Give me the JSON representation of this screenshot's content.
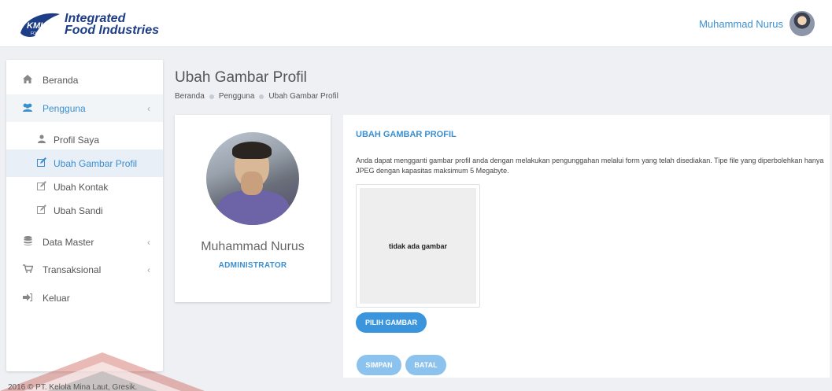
{
  "brand": {
    "line1": "Integrated",
    "line2": "Food Industries",
    "mark_text": "KML",
    "mark_sub": "FOOD"
  },
  "user": {
    "name": "Muhammad Nurus"
  },
  "sidebar": {
    "items": [
      {
        "label": "Beranda",
        "icon": "home-icon"
      },
      {
        "label": "Pengguna",
        "icon": "users-icon",
        "chevron": "‹"
      },
      {
        "label": "Profil Saya",
        "icon": "user-icon"
      },
      {
        "label": "Ubah Gambar Profil",
        "icon": "edit-icon"
      },
      {
        "label": "Ubah Kontak",
        "icon": "edit-icon"
      },
      {
        "label": "Ubah Sandi",
        "icon": "edit-icon"
      },
      {
        "label": "Data Master",
        "icon": "database-icon",
        "chevron": "‹"
      },
      {
        "label": "Transaksional",
        "icon": "cart-icon",
        "chevron": "‹"
      },
      {
        "label": "Keluar",
        "icon": "sign-out-icon"
      }
    ]
  },
  "page": {
    "title": "Ubah Gambar Profil",
    "breadcrumb": [
      "Beranda",
      "Pengguna",
      "Ubah Gambar Profil"
    ]
  },
  "profile": {
    "name": "Muhammad Nurus",
    "role": "ADMINISTRATOR"
  },
  "form": {
    "title": "UBAH GAMBAR PROFIL",
    "description": "Anda dapat mengganti gambar profil anda dengan melakukan pengunggahan melalui form yang telah disediakan. Tipe file yang diperbolehkan hanya JPEG dengan kapasitas maksimum 5 Megabyte.",
    "preview_text": "tidak ada gambar",
    "pick_button": "PILIH GAMBAR",
    "save_button": "SIMPAN",
    "cancel_button": "BATAL"
  },
  "footer": {
    "text": "2016 © PT. Kelola Mina Laut, Gresik."
  },
  "colors": {
    "accent": "#3b8fd0",
    "brand": "#1d3d86",
    "button": "#3a95dd",
    "button_disabled": "#8cc3ee",
    "watermark": "#c0392b"
  }
}
